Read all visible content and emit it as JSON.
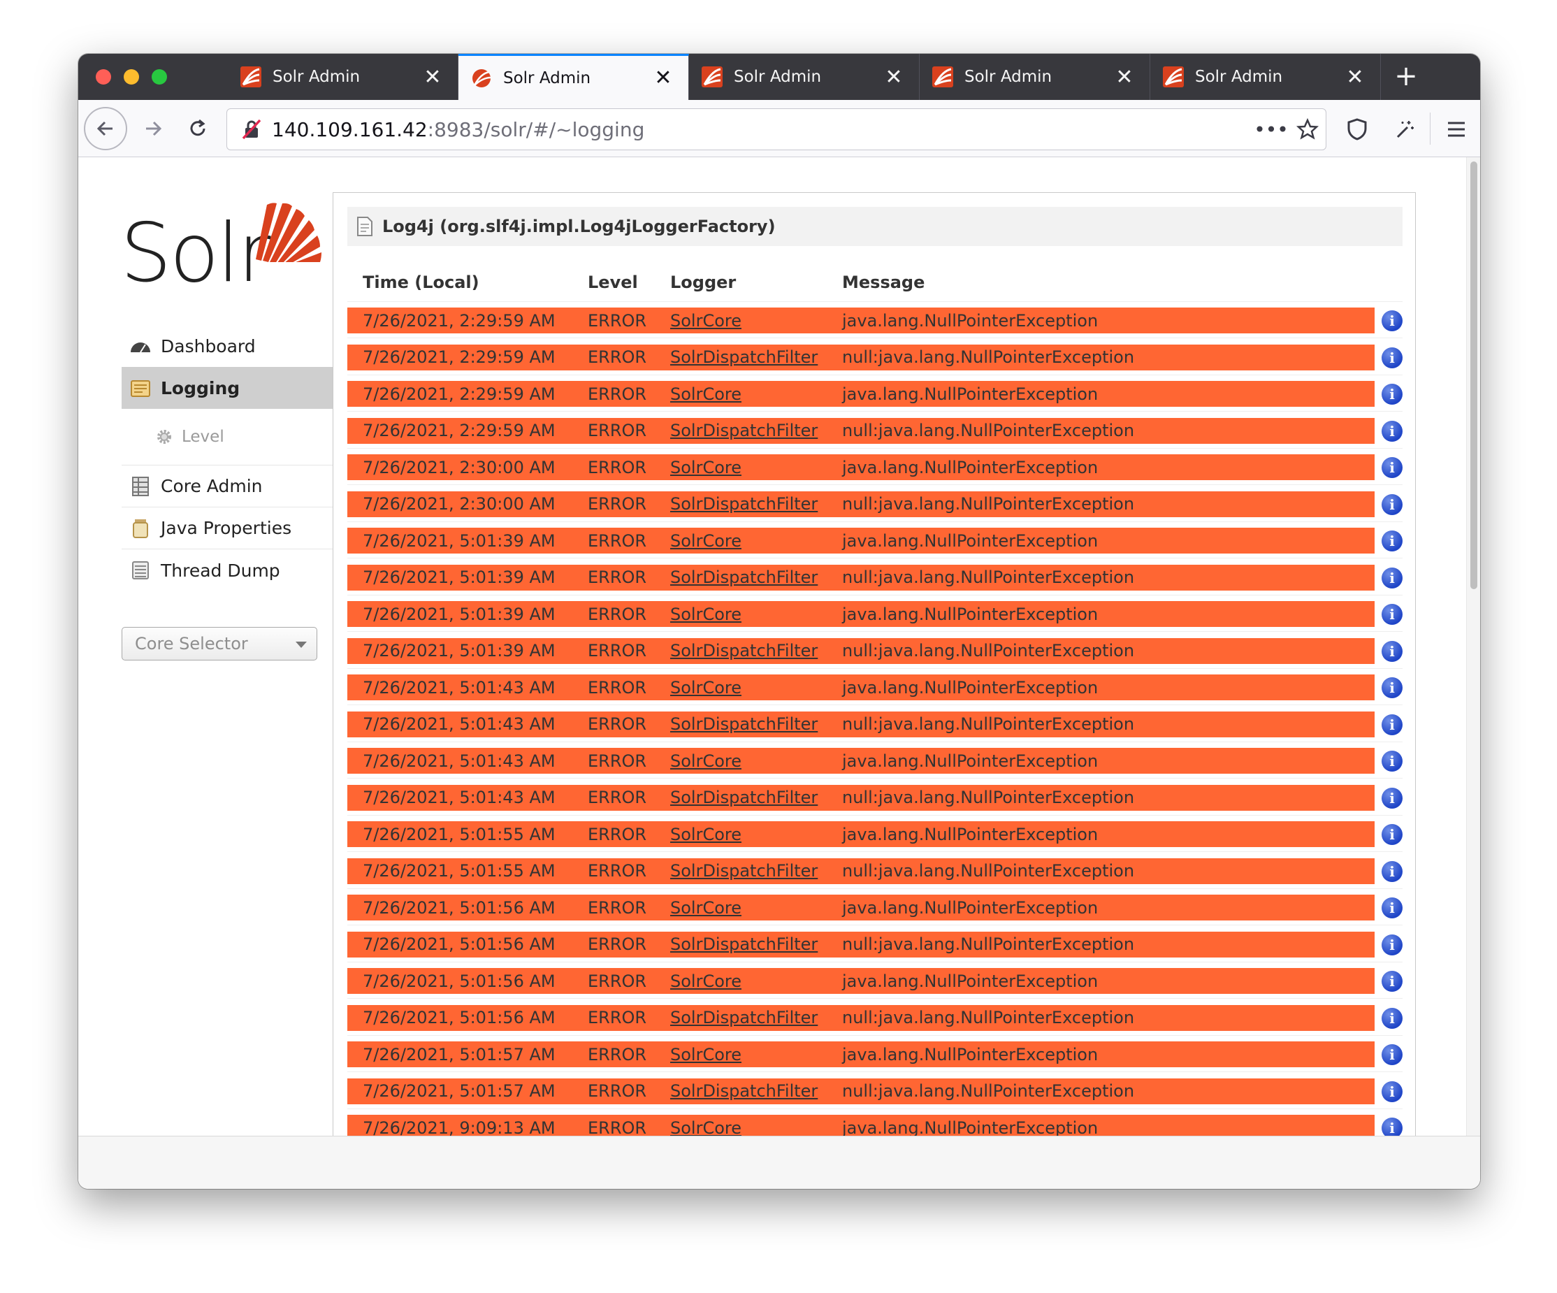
{
  "browser": {
    "tabs": [
      {
        "title": "Solr Admin",
        "active": false
      },
      {
        "title": "Solr Admin",
        "active": true
      },
      {
        "title": "Solr Admin",
        "active": false
      },
      {
        "title": "Solr Admin",
        "active": false
      },
      {
        "title": "Solr Admin",
        "active": false
      }
    ],
    "url_host": "140.109.161.42",
    "url_rest": ":8983/solr/#/~logging",
    "more_icon": "•••"
  },
  "logo": {
    "text": "Solr"
  },
  "sidebar": {
    "items": [
      {
        "label": "Dashboard",
        "icon": "dashboard-icon"
      },
      {
        "label": "Logging",
        "icon": "logging-icon",
        "active": true
      },
      {
        "label": "Level",
        "icon": "gear-icon",
        "sub": true
      },
      {
        "label": "Core Admin",
        "icon": "core-admin-icon"
      },
      {
        "label": "Java Properties",
        "icon": "java-properties-icon"
      },
      {
        "label": "Thread Dump",
        "icon": "thread-dump-icon"
      }
    ],
    "core_selector": "Core Selector"
  },
  "panel": {
    "title": "Log4j (org.slf4j.impl.Log4jLoggerFactory)",
    "columns": {
      "time": "Time (Local)",
      "level": "Level",
      "logger": "Logger",
      "message": "Message"
    },
    "rows": [
      {
        "time": "7/26/2021, 2:29:59 AM",
        "level": "ERROR",
        "logger": "SolrCore",
        "message": "java.lang.NullPointerException"
      },
      {
        "time": "7/26/2021, 2:29:59 AM",
        "level": "ERROR",
        "logger": "SolrDispatchFilter",
        "message": "null:java.lang.NullPointerException"
      },
      {
        "time": "7/26/2021, 2:29:59 AM",
        "level": "ERROR",
        "logger": "SolrCore",
        "message": "java.lang.NullPointerException"
      },
      {
        "time": "7/26/2021, 2:29:59 AM",
        "level": "ERROR",
        "logger": "SolrDispatchFilter",
        "message": "null:java.lang.NullPointerException"
      },
      {
        "time": "7/26/2021, 2:30:00 AM",
        "level": "ERROR",
        "logger": "SolrCore",
        "message": "java.lang.NullPointerException"
      },
      {
        "time": "7/26/2021, 2:30:00 AM",
        "level": "ERROR",
        "logger": "SolrDispatchFilter",
        "message": "null:java.lang.NullPointerException"
      },
      {
        "time": "7/26/2021, 5:01:39 AM",
        "level": "ERROR",
        "logger": "SolrCore",
        "message": "java.lang.NullPointerException"
      },
      {
        "time": "7/26/2021, 5:01:39 AM",
        "level": "ERROR",
        "logger": "SolrDispatchFilter",
        "message": "null:java.lang.NullPointerException"
      },
      {
        "time": "7/26/2021, 5:01:39 AM",
        "level": "ERROR",
        "logger": "SolrCore",
        "message": "java.lang.NullPointerException"
      },
      {
        "time": "7/26/2021, 5:01:39 AM",
        "level": "ERROR",
        "logger": "SolrDispatchFilter",
        "message": "null:java.lang.NullPointerException"
      },
      {
        "time": "7/26/2021, 5:01:43 AM",
        "level": "ERROR",
        "logger": "SolrCore",
        "message": "java.lang.NullPointerException"
      },
      {
        "time": "7/26/2021, 5:01:43 AM",
        "level": "ERROR",
        "logger": "SolrDispatchFilter",
        "message": "null:java.lang.NullPointerException"
      },
      {
        "time": "7/26/2021, 5:01:43 AM",
        "level": "ERROR",
        "logger": "SolrCore",
        "message": "java.lang.NullPointerException"
      },
      {
        "time": "7/26/2021, 5:01:43 AM",
        "level": "ERROR",
        "logger": "SolrDispatchFilter",
        "message": "null:java.lang.NullPointerException"
      },
      {
        "time": "7/26/2021, 5:01:55 AM",
        "level": "ERROR",
        "logger": "SolrCore",
        "message": "java.lang.NullPointerException"
      },
      {
        "time": "7/26/2021, 5:01:55 AM",
        "level": "ERROR",
        "logger": "SolrDispatchFilter",
        "message": "null:java.lang.NullPointerException"
      },
      {
        "time": "7/26/2021, 5:01:56 AM",
        "level": "ERROR",
        "logger": "SolrCore",
        "message": "java.lang.NullPointerException"
      },
      {
        "time": "7/26/2021, 5:01:56 AM",
        "level": "ERROR",
        "logger": "SolrDispatchFilter",
        "message": "null:java.lang.NullPointerException"
      },
      {
        "time": "7/26/2021, 5:01:56 AM",
        "level": "ERROR",
        "logger": "SolrCore",
        "message": "java.lang.NullPointerException"
      },
      {
        "time": "7/26/2021, 5:01:56 AM",
        "level": "ERROR",
        "logger": "SolrDispatchFilter",
        "message": "null:java.lang.NullPointerException"
      },
      {
        "time": "7/26/2021, 5:01:57 AM",
        "level": "ERROR",
        "logger": "SolrCore",
        "message": "java.lang.NullPointerException"
      },
      {
        "time": "7/26/2021, 5:01:57 AM",
        "level": "ERROR",
        "logger": "SolrDispatchFilter",
        "message": "null:java.lang.NullPointerException"
      },
      {
        "time": "7/26/2021, 9:09:13 AM",
        "level": "ERROR",
        "logger": "SolrCore",
        "message": "java.lang.NullPointerException"
      }
    ]
  },
  "colors": {
    "error_row": "#ff6633",
    "accent": "#0a84ff",
    "logo_red": "#d9411e"
  }
}
